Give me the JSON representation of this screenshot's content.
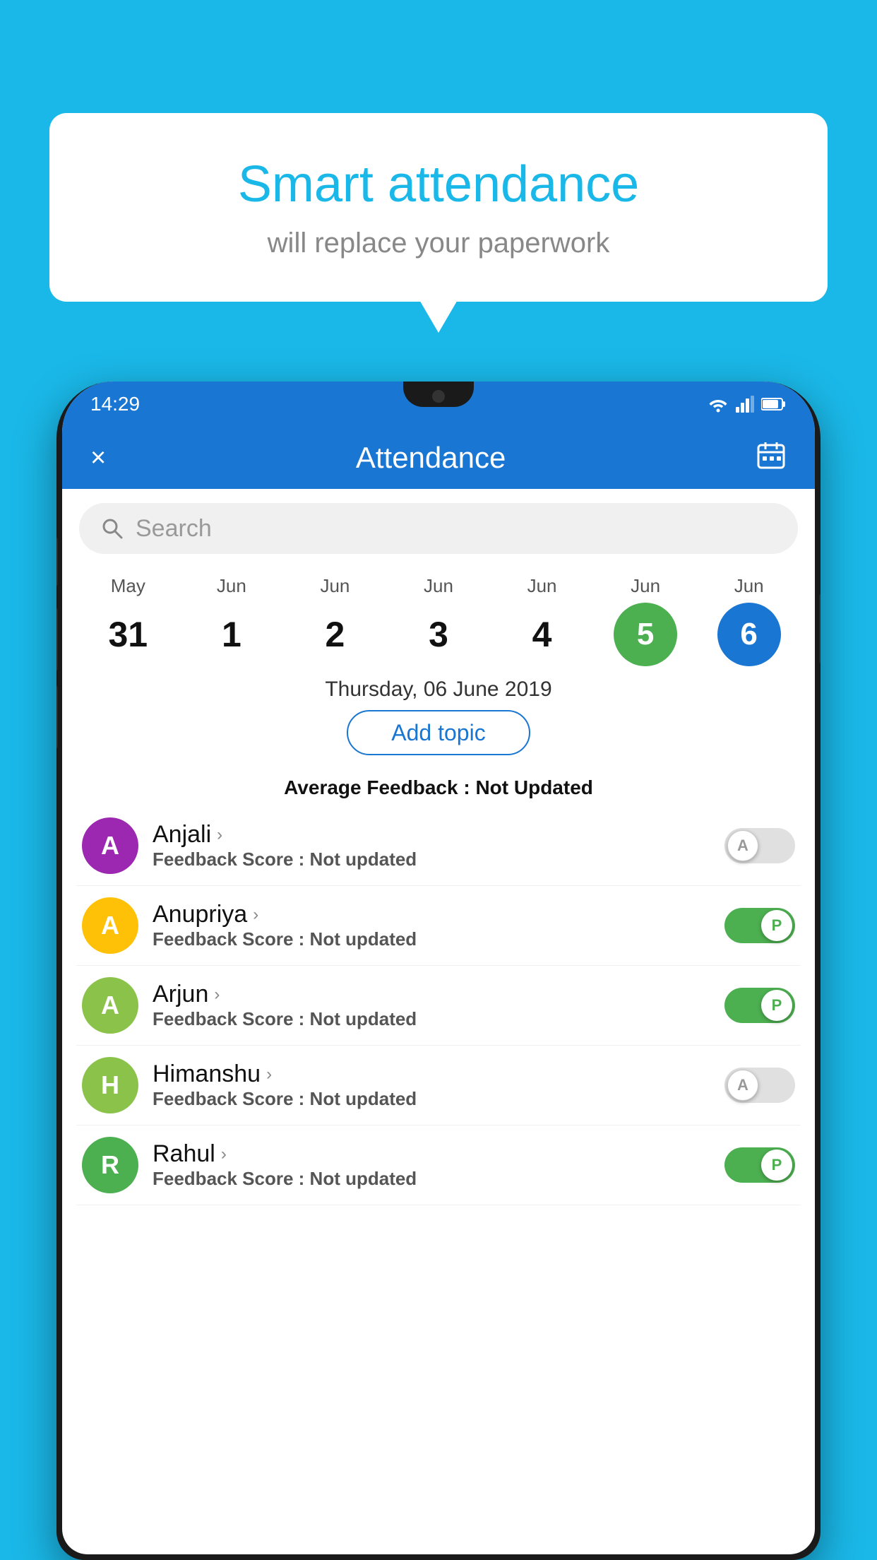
{
  "background_color": "#1AB8E8",
  "bubble": {
    "title": "Smart attendance",
    "subtitle": "will replace your paperwork"
  },
  "status_bar": {
    "time": "14:29",
    "icons": [
      "wifi",
      "signal",
      "battery"
    ]
  },
  "header": {
    "title": "Attendance",
    "close_label": "×",
    "calendar_icon": "📅"
  },
  "search": {
    "placeholder": "Search"
  },
  "calendar": {
    "items": [
      {
        "month": "May",
        "day": "31",
        "style": "normal"
      },
      {
        "month": "Jun",
        "day": "1",
        "style": "normal"
      },
      {
        "month": "Jun",
        "day": "2",
        "style": "normal"
      },
      {
        "month": "Jun",
        "day": "3",
        "style": "normal"
      },
      {
        "month": "Jun",
        "day": "4",
        "style": "normal"
      },
      {
        "month": "Jun",
        "day": "5",
        "style": "today"
      },
      {
        "month": "Jun",
        "day": "6",
        "style": "selected"
      }
    ]
  },
  "selected_date": "Thursday, 06 June 2019",
  "add_topic_label": "Add topic",
  "avg_feedback_label": "Average Feedback : ",
  "avg_feedback_value": "Not Updated",
  "students": [
    {
      "name": "Anjali",
      "initial": "A",
      "avatar_color": "#9C27B0",
      "feedback_label": "Feedback Score : ",
      "feedback_value": "Not updated",
      "toggle": "off",
      "toggle_letter": "A"
    },
    {
      "name": "Anupriya",
      "initial": "A",
      "avatar_color": "#FFC107",
      "feedback_label": "Feedback Score : ",
      "feedback_value": "Not updated",
      "toggle": "on",
      "toggle_letter": "P"
    },
    {
      "name": "Arjun",
      "initial": "A",
      "avatar_color": "#8BC34A",
      "feedback_label": "Feedback Score : ",
      "feedback_value": "Not updated",
      "toggle": "on",
      "toggle_letter": "P"
    },
    {
      "name": "Himanshu",
      "initial": "H",
      "avatar_color": "#8BC34A",
      "feedback_label": "Feedback Score : ",
      "feedback_value": "Not updated",
      "toggle": "off",
      "toggle_letter": "A"
    },
    {
      "name": "Rahul",
      "initial": "R",
      "avatar_color": "#4CAF50",
      "feedback_label": "Feedback Score : ",
      "feedback_value": "Not updated",
      "toggle": "on",
      "toggle_letter": "P"
    }
  ]
}
